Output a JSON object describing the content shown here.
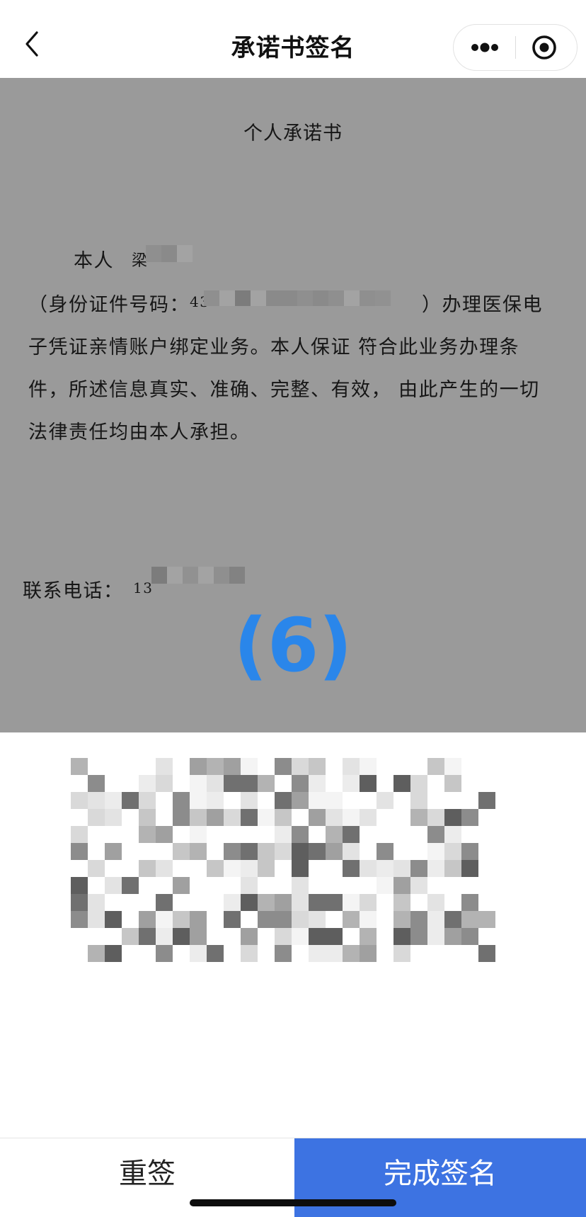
{
  "navbar": {
    "back_icon": "chevron-left-icon",
    "title": "承诺书签名",
    "more_icon": "more-dots-icon",
    "close_icon": "target-circle-icon"
  },
  "document": {
    "title": "个人承诺书",
    "name_label": "本人",
    "name_prefix": "梁",
    "id_label": "（身份证件号码：",
    "id_prefix": "43",
    "id_tail": "）办理医保电",
    "body_lines": [
      "子凭证亲情账户绑定业务。本人保证  符合此业务办理条",
      "件，所述信息真实、准确、完整、有效，  由此产生的一切",
      "法律责任均由本人承担。"
    ],
    "phone_label": "联系电话：",
    "phone_prefix": "13",
    "countdown": "(6)"
  },
  "signature_pad": {
    "state": "signed (pixelated)"
  },
  "actions": {
    "resign_label": "重签",
    "finish_label": "完成签名"
  },
  "colors": {
    "document_bg": "#9a9a9a",
    "countdown": "#2a86ea",
    "primary_button": "#3d73e2"
  }
}
